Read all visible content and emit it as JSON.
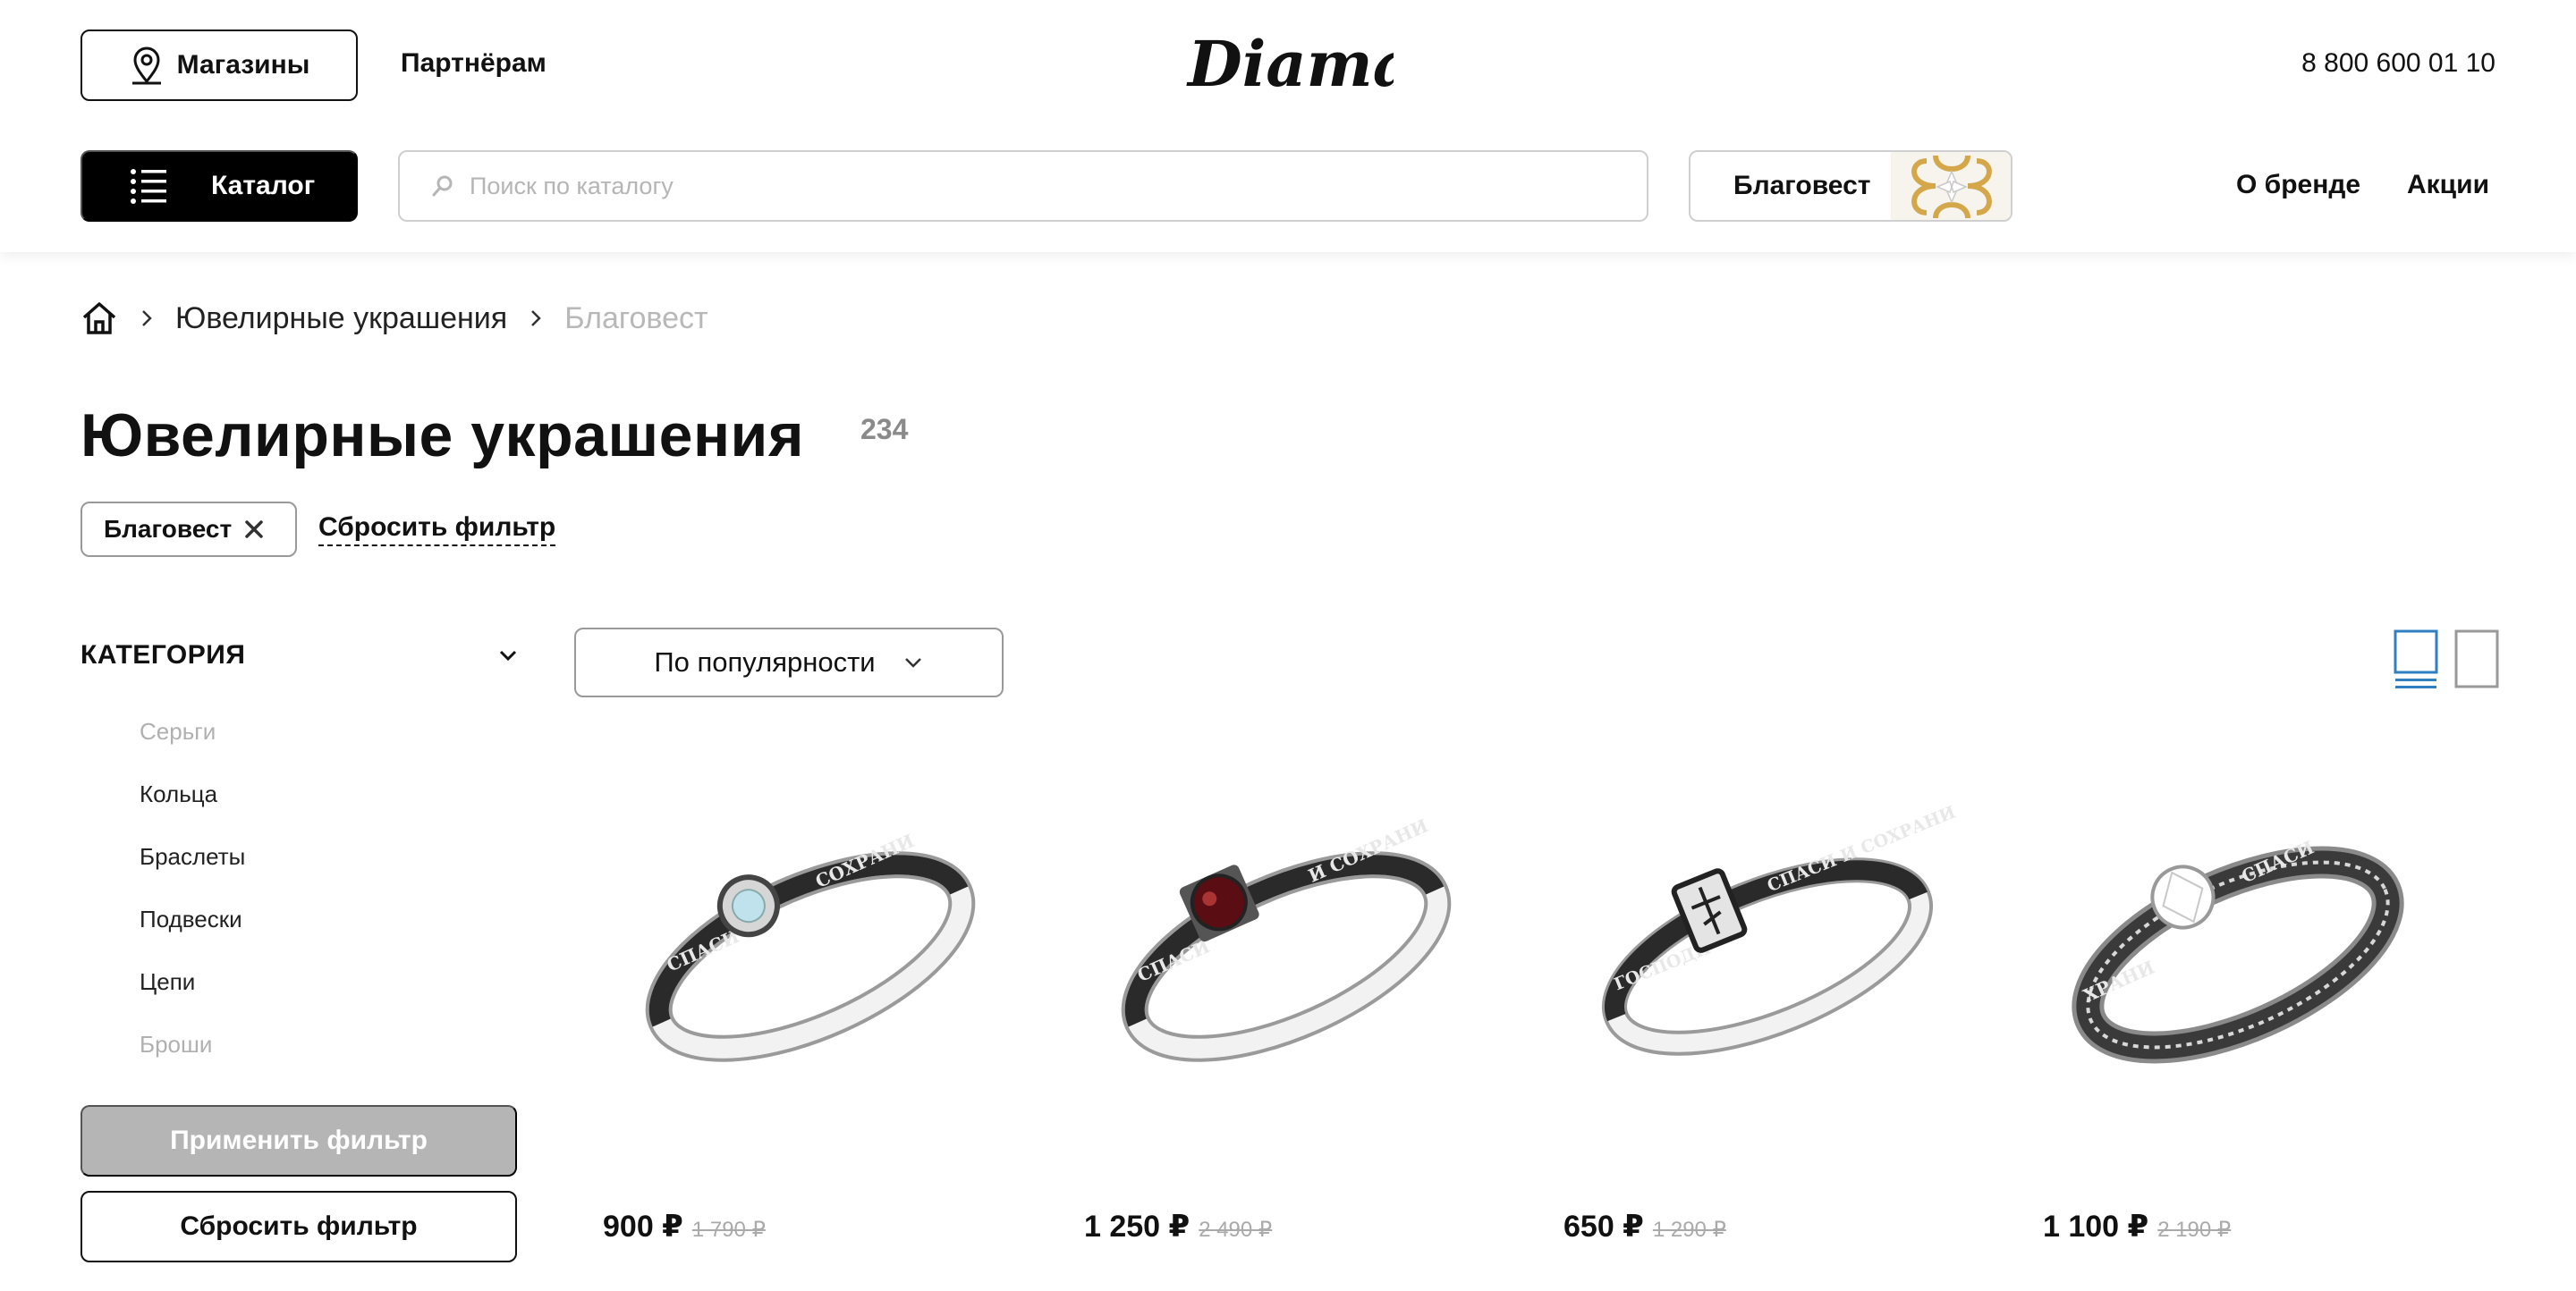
{
  "header": {
    "stores_label": "Магазины",
    "partners_label": "Партнёрам",
    "logo_text": "Diamant",
    "phone": "8 800 600 01 10",
    "catalog_label": "Каталог",
    "search_placeholder": "Поиск по каталогу",
    "brand_button_label": "Благовест",
    "nav": [
      "О бренде",
      "Акции"
    ]
  },
  "breadcrumb": {
    "home_icon": "home-icon",
    "items": [
      "Ювелирные украшения",
      "Благовест"
    ]
  },
  "page": {
    "title": "Ювелирные украшения",
    "count": "234",
    "active_filter": "Благовест",
    "reset_filter_link": "Сбросить фильтр"
  },
  "sidebar": {
    "category_header": "КАТЕГОРИЯ",
    "categories": [
      {
        "label": "Серьги",
        "enabled": false
      },
      {
        "label": "Кольца",
        "enabled": true
      },
      {
        "label": "Браслеты",
        "enabled": true
      },
      {
        "label": "Подвески",
        "enabled": true
      },
      {
        "label": "Цепи",
        "enabled": true
      },
      {
        "label": "Броши",
        "enabled": false
      }
    ],
    "apply_label": "Применить фильтр",
    "reset_label": "Сбросить фильтр"
  },
  "sort": {
    "selected": "По популярности"
  },
  "view": {
    "active": "list",
    "accent_color": "#2f7fc1"
  },
  "products": [
    {
      "price": "900 ₽",
      "old_price": "1 790 ₽",
      "stone": "blue topaz"
    },
    {
      "price": "1 250 ₽",
      "old_price": "2 490 ₽",
      "stone": "garnet"
    },
    {
      "price": "650 ₽",
      "old_price": "1 290 ₽",
      "stone": "none"
    },
    {
      "price": "1 100 ₽",
      "old_price": "2 190 ₽",
      "stone": "cubic zirconia"
    }
  ],
  "colors": {
    "primary": "#000000",
    "disabled_button": "#b5b5b5",
    "muted_text": "#b0b0b0"
  }
}
